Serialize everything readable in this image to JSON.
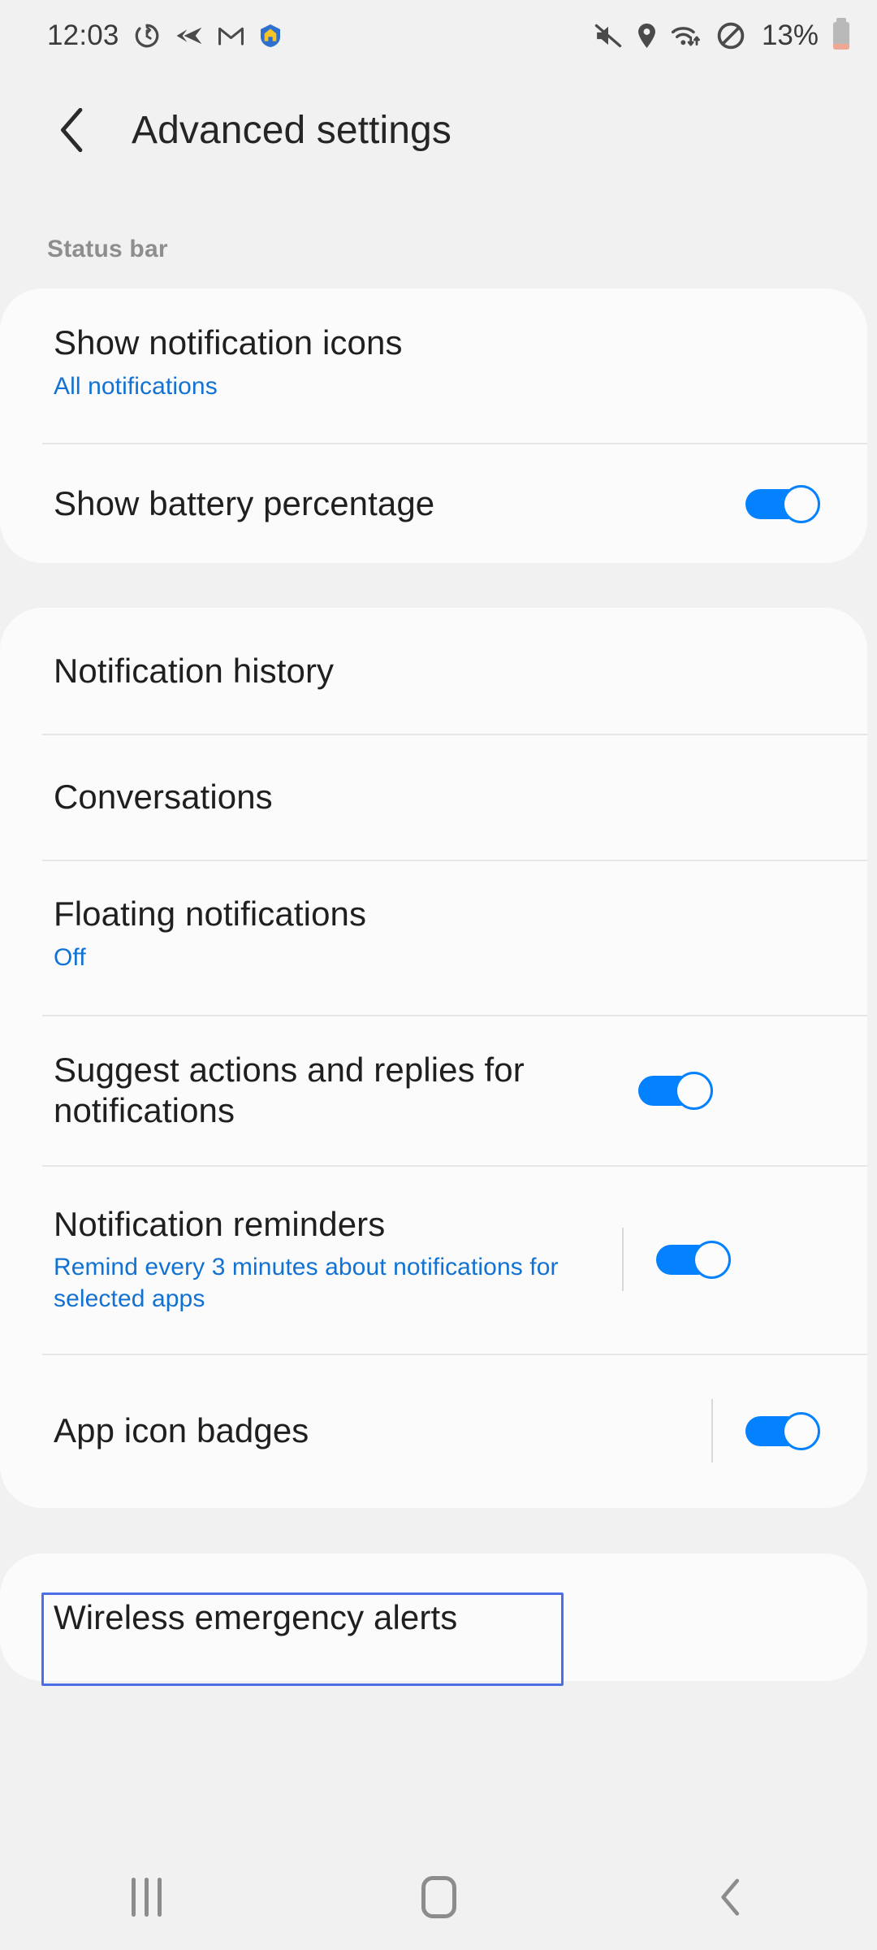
{
  "status_bar": {
    "time": "12:03",
    "left_icons": [
      "sync-icon",
      "send-arrow-icon",
      "gmail-icon",
      "home-shield-icon"
    ],
    "right_icons": [
      "mute-icon",
      "location-icon",
      "wifi-icon",
      "do-not-disturb-icon"
    ],
    "battery_percent": "13%",
    "battery_icon": "battery-low-icon"
  },
  "header": {
    "back_icon": "chevron-left-icon",
    "title": "Advanced settings"
  },
  "sections": [
    {
      "label": "Status bar",
      "items": [
        {
          "title": "Show notification icons",
          "subtitle": "All notifications",
          "control": "none"
        },
        {
          "title": "Show battery percentage",
          "subtitle": "",
          "control": "toggle",
          "toggle_on": true,
          "has_divider_bar": false
        }
      ]
    },
    {
      "label": "",
      "items": [
        {
          "title": "Notification history",
          "subtitle": "",
          "control": "none"
        },
        {
          "title": "Conversations",
          "subtitle": "",
          "control": "none"
        },
        {
          "title": "Floating notifications",
          "subtitle": "Off",
          "control": "none"
        },
        {
          "title": "Suggest actions and replies for notifications",
          "subtitle": "",
          "control": "toggle",
          "toggle_on": true,
          "has_divider_bar": false
        },
        {
          "title": "Notification reminders",
          "subtitle": "Remind every 3 minutes about notifications for selected apps",
          "control": "toggle",
          "toggle_on": true,
          "has_divider_bar": true
        },
        {
          "title": "App icon badges",
          "subtitle": "",
          "control": "toggle",
          "toggle_on": true,
          "has_divider_bar": true
        }
      ]
    },
    {
      "label": "",
      "items": [
        {
          "title": "Wireless emergency alerts",
          "subtitle": "",
          "control": "none",
          "focused": true
        }
      ]
    }
  ],
  "nav_bar": {
    "recents_label": "recents-icon",
    "home_label": "home-icon",
    "back_label": "back-icon"
  },
  "colors": {
    "accent_blue": "#0381fe",
    "link_blue": "#1272d3",
    "card_bg": "#fbfbfb",
    "page_bg": "#f1f1f1",
    "focus_border": "#4b6fe8"
  }
}
